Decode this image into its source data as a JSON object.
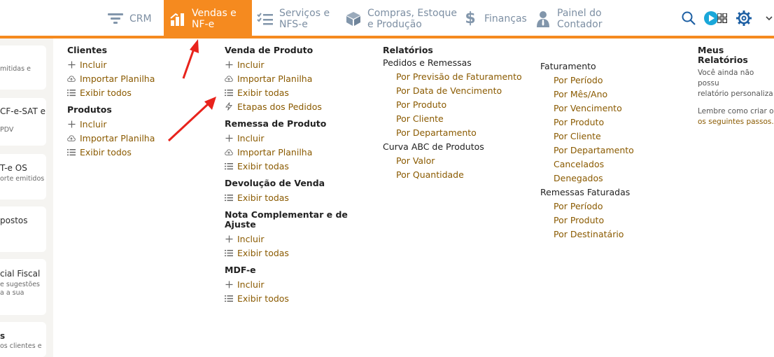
{
  "nav": {
    "items": [
      {
        "label": "CRM",
        "icon": "funnel-icon"
      },
      {
        "label": "Vendas e\nNF-e",
        "icon": "bar-chart-icon",
        "active": true
      },
      {
        "label": "Serviços e\nNFS-e",
        "icon": "checklist-icon"
      },
      {
        "label": "Compras, Estoque\ne Produção",
        "icon": "box-icon"
      },
      {
        "label": "Finanças",
        "icon": "dollar-icon"
      },
      {
        "label": "Painel do\nContador",
        "icon": "person-icon"
      }
    ],
    "right_icons": [
      "search-icon",
      "play-app-icon",
      "grid-icon",
      "gear-icon",
      "chevron-down-icon"
    ]
  },
  "left_cards": [
    {
      "title": "",
      "sub": "mitidas e"
    },
    {
      "title": "CF-e-SAT e",
      "sub": "PDV"
    },
    {
      "title": "T-e OS",
      "sub": "orte emitidos"
    },
    {
      "title": "postos",
      "sub": ""
    },
    {
      "title": "cial Fiscal",
      "sub": "e sugestões\na a sua"
    },
    {
      "title": "s",
      "sub": "os clientes e"
    }
  ],
  "menu": {
    "col1": [
      {
        "title": "Clientes",
        "items": [
          {
            "icon": "plus-icon",
            "label": "Incluir"
          },
          {
            "icon": "cloud-upload-icon",
            "label": "Importar Planilha"
          },
          {
            "icon": "list-icon",
            "label": "Exibir todos"
          }
        ]
      },
      {
        "title": "Produtos",
        "items": [
          {
            "icon": "plus-icon",
            "label": "Incluir"
          },
          {
            "icon": "cloud-upload-icon",
            "label": "Importar Planilha"
          },
          {
            "icon": "list-icon",
            "label": "Exibir todos"
          }
        ]
      }
    ],
    "col2": [
      {
        "title": "Venda de Produto",
        "items": [
          {
            "icon": "plus-icon",
            "label": "Incluir"
          },
          {
            "icon": "cloud-upload-icon",
            "label": "Importar Planilha"
          },
          {
            "icon": "list-icon",
            "label": "Exibir todas"
          },
          {
            "icon": "bolt-icon",
            "label": "Etapas dos Pedidos"
          }
        ]
      },
      {
        "title": "Remessa de Produto",
        "items": [
          {
            "icon": "plus-icon",
            "label": "Incluir"
          },
          {
            "icon": "cloud-upload-icon",
            "label": "Importar Planilha"
          },
          {
            "icon": "list-icon",
            "label": "Exibir todas"
          }
        ]
      },
      {
        "title": "Devolução de Venda",
        "items": [
          {
            "icon": "list-icon",
            "label": "Exibir todas"
          }
        ]
      },
      {
        "title": "Nota Complementar e de\nAjuste",
        "items": [
          {
            "icon": "plus-icon",
            "label": "Incluir"
          },
          {
            "icon": "list-icon",
            "label": "Exibir todas"
          }
        ]
      },
      {
        "title": "MDF-e",
        "items": [
          {
            "icon": "plus-icon",
            "label": "Incluir"
          },
          {
            "icon": "list-icon",
            "label": "Exibir todos"
          }
        ]
      }
    ],
    "col3": {
      "title": "Relatórios",
      "groups": [
        {
          "label": "Pedidos e Remessas",
          "links": [
            "Por Previsão de Faturamento",
            "Por Data de Vencimento",
            "Por Produto",
            "Por Cliente",
            "Por Departamento"
          ]
        },
        {
          "label": "Curva ABC de Produtos",
          "links": [
            "Por Valor",
            "Por Quantidade"
          ]
        }
      ]
    },
    "col4": {
      "groups": [
        {
          "label": "Faturamento",
          "links": [
            "Por Período",
            "Por Mês/Ano",
            "Por Vencimento",
            "Por Produto",
            "Por Cliente",
            "Por Departamento",
            "Cancelados",
            "Denegados"
          ]
        },
        {
          "label": "Remessas Faturadas",
          "links": [
            "Por Período",
            "Por Produto",
            "Por Destinatário"
          ]
        }
      ]
    },
    "col5": {
      "title": "Meus Relatórios",
      "text": "Você ainda não possu\nrelatório personaliza",
      "hint": "Lembre como criar o",
      "link": "os seguintes passos."
    }
  },
  "colors": {
    "accent": "#f58a1f",
    "link": "#8a5a00",
    "annotation_arrow": "#e8231c"
  }
}
